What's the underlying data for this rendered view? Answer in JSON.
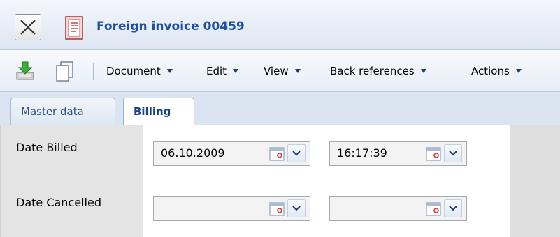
{
  "window": {
    "title": "Foreign invoice 00459"
  },
  "toolbar": {
    "menus": [
      {
        "label": "Document"
      },
      {
        "label": "Edit"
      },
      {
        "label": "View"
      },
      {
        "label": "Back references"
      },
      {
        "label": "Actions"
      }
    ]
  },
  "tabs": [
    {
      "label": "Master data",
      "active": false
    },
    {
      "label": "Billing",
      "active": true
    }
  ],
  "form": {
    "rows": [
      {
        "label": "Date Billed",
        "date": "06.10.2009",
        "time": "16:17:39"
      },
      {
        "label": "Date Cancelled",
        "date": "",
        "time": ""
      }
    ]
  },
  "colors": {
    "title_text": "#1f4fa0",
    "active_tab_text": "#15428b",
    "caret": "#1f3b73"
  }
}
